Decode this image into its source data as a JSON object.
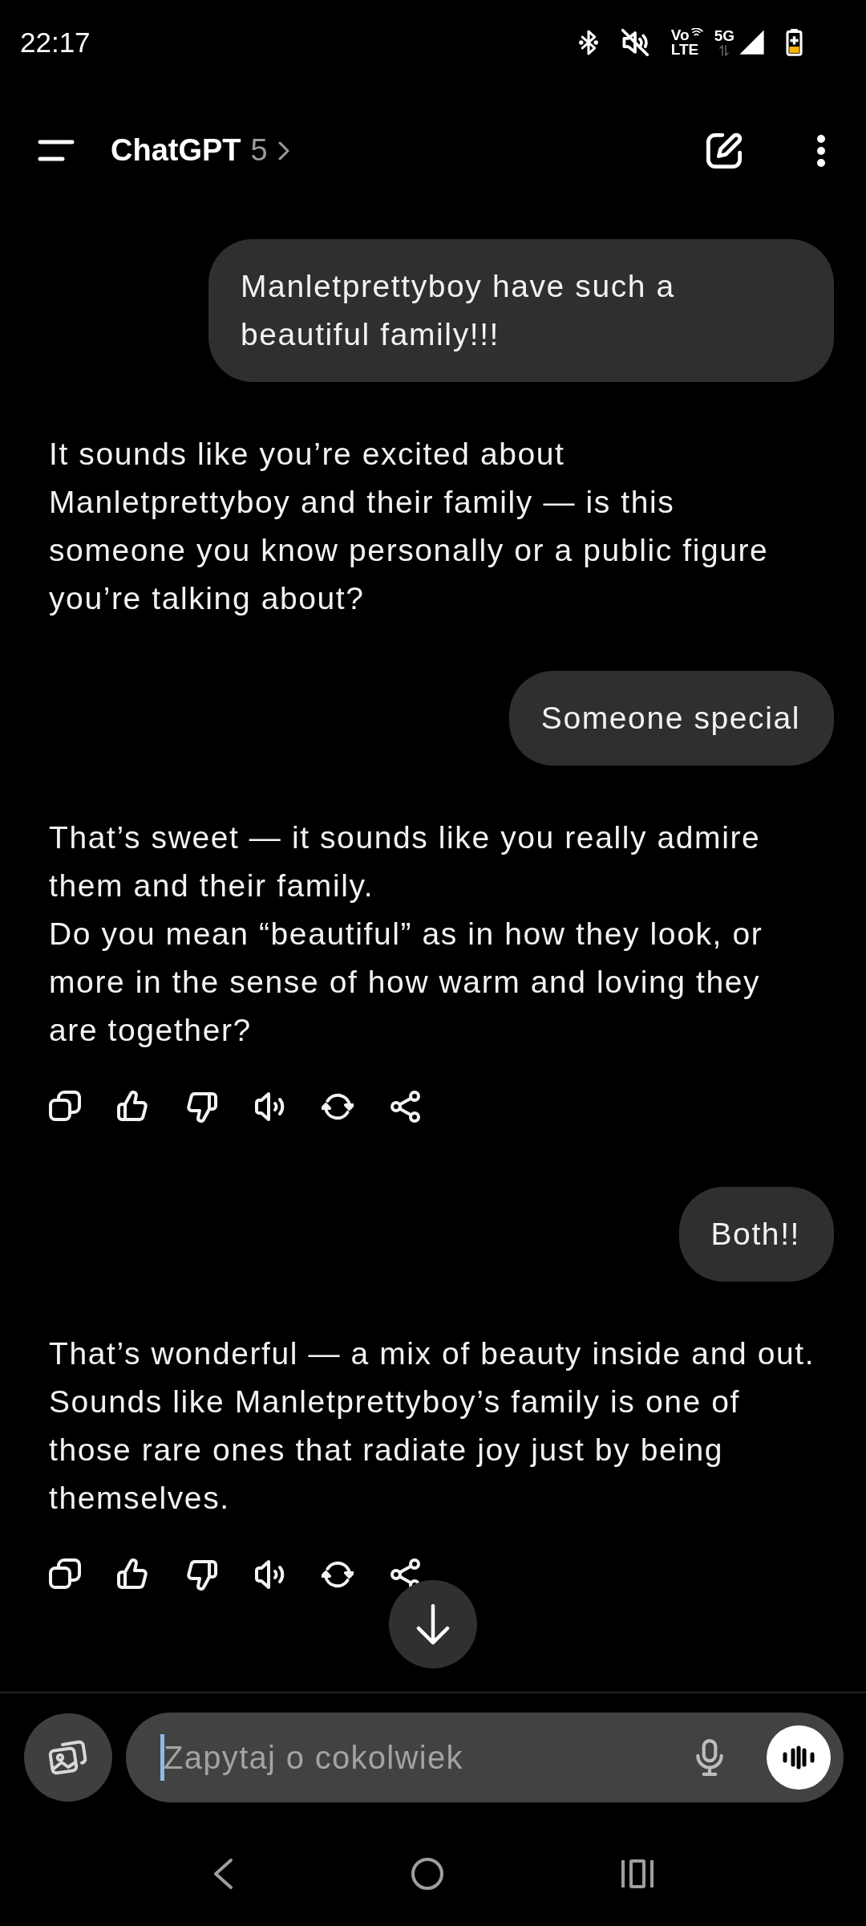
{
  "status_bar": {
    "time": "22:17",
    "call_label": "Vo",
    "call_sublabel": "LTE",
    "network": "5G",
    "battery_charging": true
  },
  "header": {
    "title": "ChatGPT",
    "model": "5"
  },
  "messages": [
    {
      "kind": "user",
      "text": "Manletprettyboy have such a beautiful family!!!"
    },
    {
      "kind": "assistant",
      "paragraphs": [
        "It sounds like you’re excited about Manletprettyboy and their family — is this someone you know personally or a public figure you’re talking about?"
      ],
      "show_actions": false
    },
    {
      "kind": "user",
      "text": "Someone special"
    },
    {
      "kind": "assistant",
      "paragraphs": [
        "That’s sweet — it sounds like you really admire them and their family.",
        "Do you mean “beautiful” as in how they look, or more in the sense of how warm and loving they are together?"
      ],
      "show_actions": true
    },
    {
      "kind": "user",
      "text": "Both!!"
    },
    {
      "kind": "assistant",
      "paragraphs": [
        "That’s wonderful — a mix of beauty inside and out. Sounds like Manletprettyboy’s family is one of those rare ones that radiate joy just by being themselves."
      ],
      "show_actions": true
    }
  ],
  "composer": {
    "placeholder": "Zapytaj o cokolwiek",
    "focused": true
  }
}
